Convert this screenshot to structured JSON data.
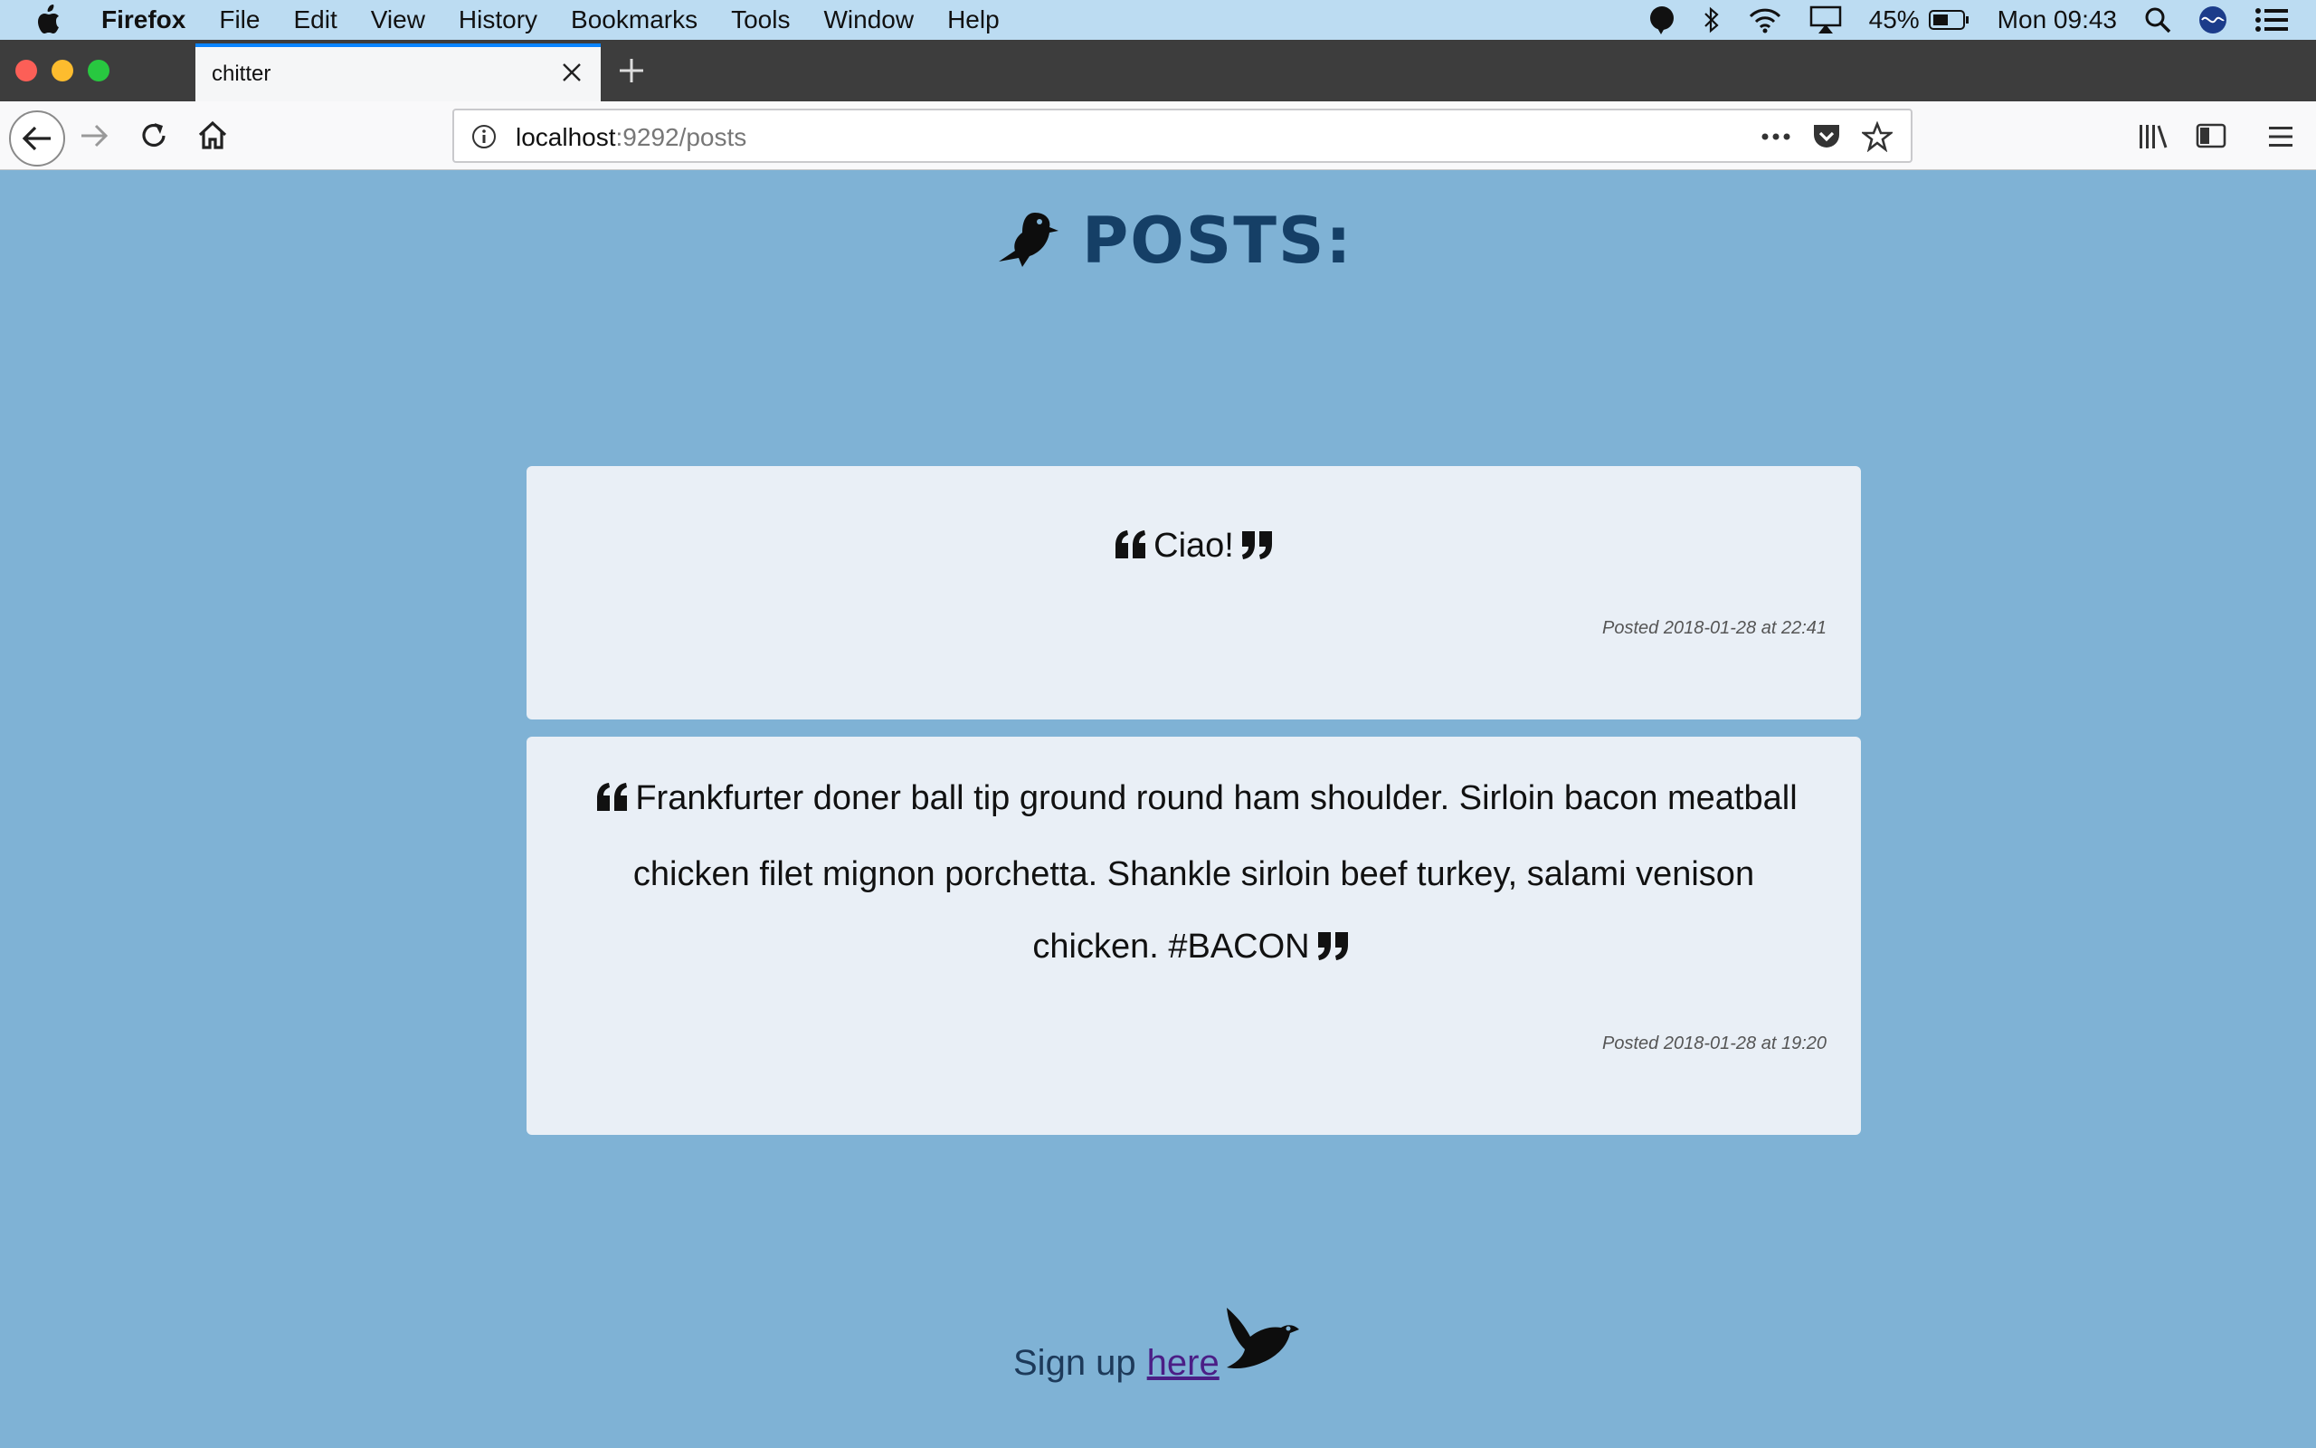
{
  "menubar": {
    "app": "Firefox",
    "items": [
      "File",
      "Edit",
      "View",
      "History",
      "Bookmarks",
      "Tools",
      "Window",
      "Help"
    ],
    "battery": "45%",
    "clock": "Mon 09:43"
  },
  "browser": {
    "tab_title": "chitter",
    "url_host": "localhost",
    "url_rest": ":9292/posts"
  },
  "page": {
    "heading": "POSTS:",
    "posts": [
      {
        "text": "Ciao!",
        "meta": "Posted 2018-01-28 at 22:41"
      },
      {
        "text": "Frankfurter doner ball tip ground round ham shoulder. Sirloin bacon meatball chicken filet mignon porchetta. Shankle sirloin beef turkey, salami venison chicken. #BACON",
        "meta": "Posted 2018-01-28 at 19:20"
      }
    ],
    "footer_text": "Sign up",
    "footer_link": "here"
  },
  "colors": {
    "page_background": "#7fb2d5",
    "card_background": "#e9eff6",
    "heading": "#153f66",
    "link": "#4b1e86",
    "tab_accent": "#0a84ff"
  }
}
